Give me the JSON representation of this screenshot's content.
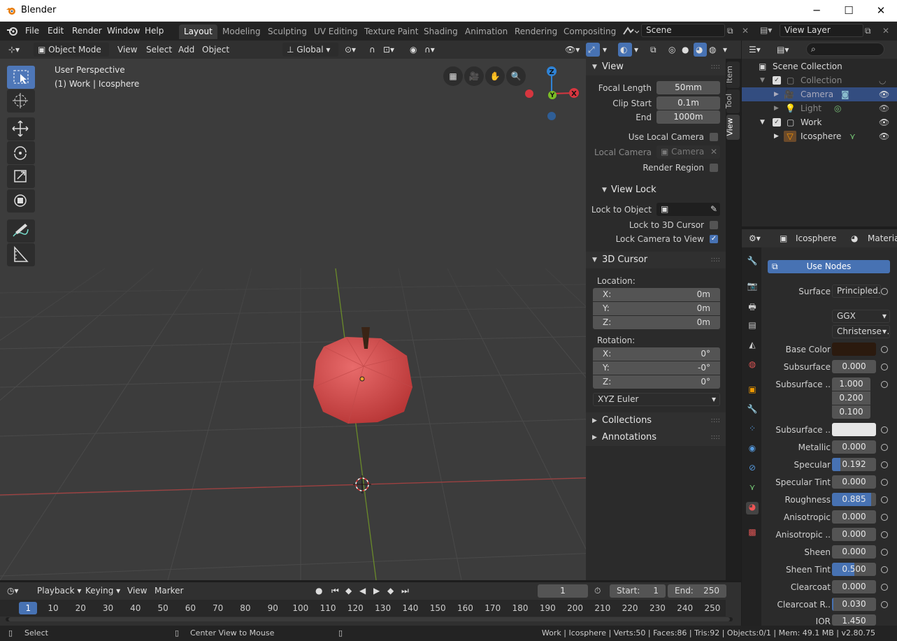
{
  "window": {
    "title": "Blender",
    "minimize": "─",
    "maximize": "☐",
    "close": "✕"
  },
  "menu": {
    "items": [
      "File",
      "Edit",
      "Render",
      "Window",
      "Help"
    ]
  },
  "workspaces": [
    "Layout",
    "Modeling",
    "Sculpting",
    "UV Editing",
    "Texture Paint",
    "Shading",
    "Animation",
    "Rendering",
    "Compositing"
  ],
  "scene": {
    "name": "Scene",
    "view_layer": "View Layer"
  },
  "viewport_header": {
    "mode": "Object Mode",
    "menus": [
      "View",
      "Select",
      "Add",
      "Object"
    ],
    "orientation": "Global"
  },
  "viewport": {
    "perspective": "User Perspective",
    "object_info": "(1) Work | Icosphere"
  },
  "gizmo": {
    "x": "X",
    "y": "Y",
    "z": "Z"
  },
  "npanel": {
    "view": {
      "header": "View",
      "focal_length_label": "Focal Length",
      "focal_length": "50mm",
      "clip_start_label": "Clip Start",
      "clip_start": "0.1m",
      "end_label": "End",
      "end": "1000m",
      "use_local_camera": "Use Local Camera",
      "local_camera_label": "Local Camera",
      "local_camera": "Camera",
      "render_region": "Render Region"
    },
    "view_lock": {
      "header": "View Lock",
      "lock_to_object": "Lock to Object",
      "lock_to_3d_cursor": "Lock to 3D Cursor",
      "lock_camera_to_view": "Lock Camera to View"
    },
    "cursor": {
      "header": "3D Cursor",
      "location": "Location:",
      "loc_x": "0m",
      "loc_y": "0m",
      "loc_z": "0m",
      "rotation": "Rotation:",
      "rot_x": "0°",
      "rot_y": "-0°",
      "rot_z": "0°",
      "mode": "XYZ Euler",
      "x": "X:",
      "y": "Y:",
      "z": "Z:"
    },
    "collections": "Collections",
    "annotations": "Annotations"
  },
  "side_tabs": [
    "Item",
    "Tool",
    "View"
  ],
  "outliner": {
    "root": "Scene Collection",
    "rows": [
      {
        "name": "Collection"
      },
      {
        "name": "Camera"
      },
      {
        "name": "Light"
      },
      {
        "name": "Work"
      },
      {
        "name": "Icosphere"
      }
    ]
  },
  "properties": {
    "object": "Icosphere",
    "tab": "Material",
    "use_nodes": "Use Nodes",
    "surface_label": "Surface",
    "surface": "Principled..",
    "dist": "GGX",
    "ss_method": "Christensen..",
    "rows": [
      {
        "label": "Base Color",
        "value": ""
      },
      {
        "label": "Subsurface",
        "value": "0.000"
      },
      {
        "label": "Subsurface ..",
        "value": "1.000"
      },
      {
        "label": "",
        "value": "0.200"
      },
      {
        "label": "",
        "value": "0.100"
      },
      {
        "label": "Subsurface ..",
        "value": ""
      },
      {
        "label": "Metallic",
        "value": "0.000"
      },
      {
        "label": "Specular",
        "value": "0.192"
      },
      {
        "label": "Specular Tint",
        "value": "0.000"
      },
      {
        "label": "Roughness",
        "value": "0.885"
      },
      {
        "label": "Anisotropic",
        "value": "0.000"
      },
      {
        "label": "Anisotropic ..",
        "value": "0.000"
      },
      {
        "label": "Sheen",
        "value": "0.000"
      },
      {
        "label": "Sheen Tint",
        "value": "0.500"
      },
      {
        "label": "Clearcoat",
        "value": "0.000"
      },
      {
        "label": "Clearcoat R..",
        "value": "0.030"
      },
      {
        "label": "IOR",
        "value": "1.450"
      }
    ],
    "specular_fill": 0.192,
    "roughness_fill": 0.885,
    "sheen_tint_fill": 0.5,
    "clearcoat_r_fill": 0.03,
    "base_color": "#2b1a0e"
  },
  "timeline": {
    "menus": [
      "Playback",
      "Keying",
      "View",
      "Marker"
    ],
    "current_frame": "1",
    "start_label": "Start:",
    "start": "1",
    "end_label": "End:",
    "end": "250",
    "ticks": [
      "1",
      "10",
      "20",
      "30",
      "40",
      "50",
      "60",
      "70",
      "80",
      "90",
      "100",
      "110",
      "120",
      "130",
      "140",
      "150",
      "160",
      "170",
      "180",
      "190",
      "200",
      "210",
      "220",
      "230",
      "240",
      "250"
    ]
  },
  "status": {
    "select": "Select",
    "center": "Center View to Mouse",
    "info": "Work | Icosphere | Verts:50 | Faces:86 | Tris:92 | Objects:0/1 | Mem: 49.1 MB | v2.80.75"
  },
  "colors": {
    "accent": "#4772b3",
    "x_axis": "#d6363f",
    "y_axis": "#7bbd26",
    "z_axis": "#2f83d6",
    "apple": "#d64545"
  }
}
